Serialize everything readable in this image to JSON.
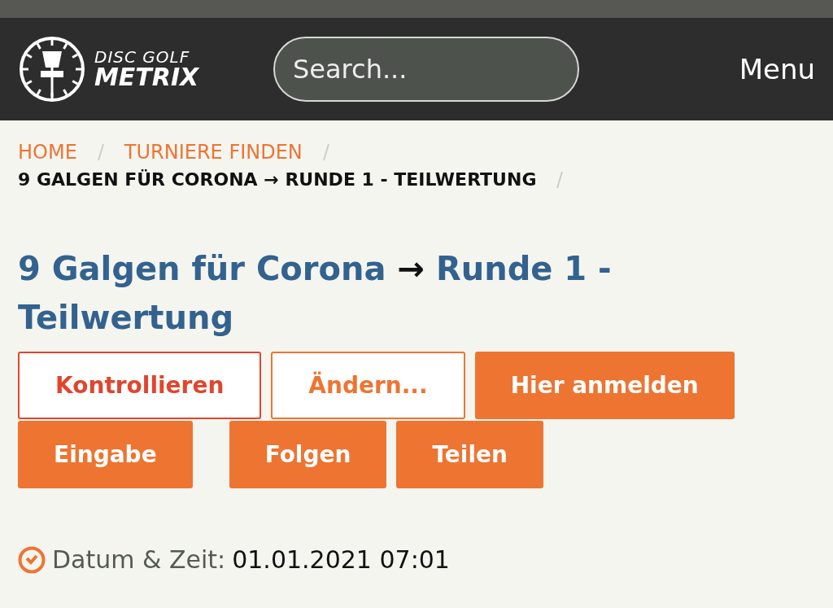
{
  "header": {
    "logo_line1": "DISC GOLF",
    "logo_line2": "METRIX",
    "search": {
      "placeholder": "Search..."
    },
    "menu": "Menu"
  },
  "breadcrumb": [
    {
      "label": "HOME",
      "kind": "link"
    },
    {
      "label": "TURNIERE FINDEN",
      "kind": "link"
    },
    {
      "label": "9 GALGEN FÜR CORONA → RUNDE 1 - TEILWERTUNG",
      "kind": "current"
    }
  ],
  "title": {
    "event": "9 Galgen für Corona",
    "separator": "→",
    "round": "Runde 1 - Teilwertung"
  },
  "button_rows": [
    [
      {
        "label": "Kontrollieren",
        "kind": "outline-red"
      },
      {
        "label": "Ändern...",
        "kind": "outline-orange"
      },
      {
        "label": "Hier anmelden",
        "kind": "filled"
      }
    ],
    [
      {
        "label": "Eingabe",
        "kind": "filled"
      },
      {
        "label": "Folgen",
        "kind": "filled"
      },
      {
        "label": "Teilen",
        "kind": "filled"
      }
    ]
  ],
  "date": {
    "label": "Datum & Zeit:",
    "value": "01.01.2021 07:01"
  }
}
